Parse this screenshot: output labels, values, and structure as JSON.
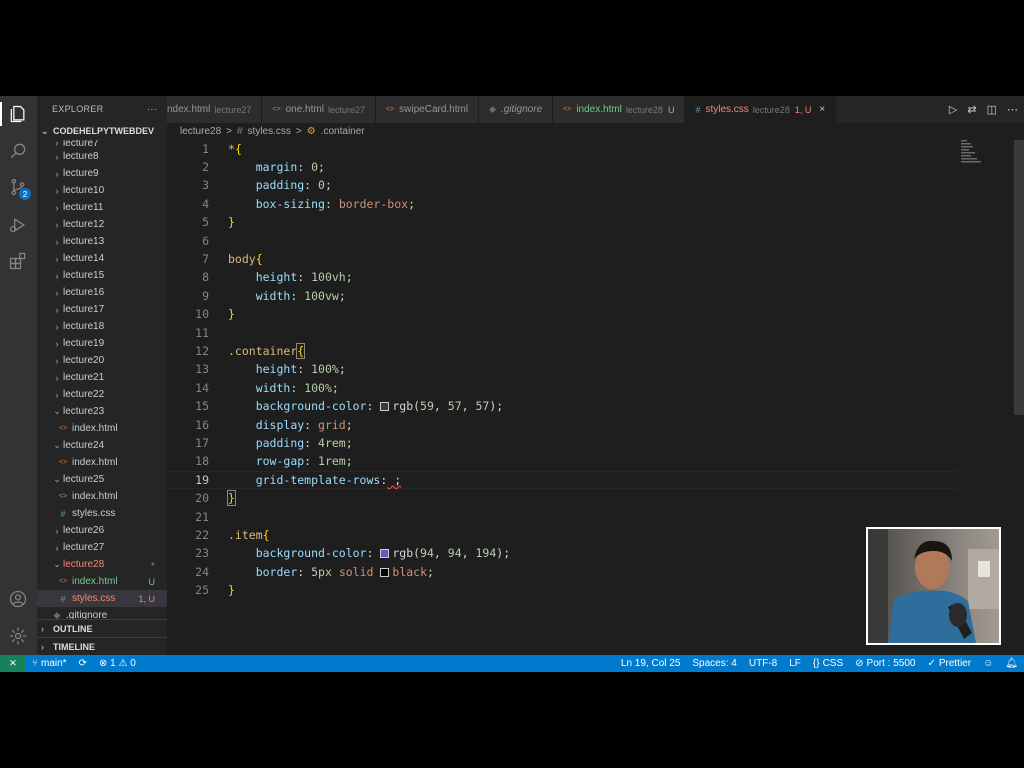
{
  "sidebar": {
    "title": "EXPLORER",
    "more": "···",
    "root": "CODEHELPYTWEBDEV",
    "partial_item": "lecture7",
    "items": [
      {
        "label": "lecture8",
        "type": "folder",
        "open": false
      },
      {
        "label": "lecture9",
        "type": "folder",
        "open": false
      },
      {
        "label": "lecture10",
        "type": "folder",
        "open": false
      },
      {
        "label": "lecture11",
        "type": "folder",
        "open": false
      },
      {
        "label": "lecture12",
        "type": "folder",
        "open": false
      },
      {
        "label": "lecture13",
        "type": "folder",
        "open": false
      },
      {
        "label": "lecture14",
        "type": "folder",
        "open": false
      },
      {
        "label": "lecture15",
        "type": "folder",
        "open": false
      },
      {
        "label": "lecture16",
        "type": "folder",
        "open": false
      },
      {
        "label": "lecture17",
        "type": "folder",
        "open": false
      },
      {
        "label": "lecture18",
        "type": "folder",
        "open": false
      },
      {
        "label": "lecture19",
        "type": "folder",
        "open": false
      },
      {
        "label": "lecture20",
        "type": "folder",
        "open": false
      },
      {
        "label": "lecture21",
        "type": "folder",
        "open": false
      },
      {
        "label": "lecture22",
        "type": "folder",
        "open": false
      },
      {
        "label": "lecture23",
        "type": "folder",
        "open": true
      },
      {
        "label": "index.html",
        "type": "html",
        "indent": 1
      },
      {
        "label": "lecture24",
        "type": "folder",
        "open": true
      },
      {
        "label": "index.html",
        "type": "html",
        "indent": 1
      },
      {
        "label": "lecture25",
        "type": "folder",
        "open": true
      },
      {
        "label": "index.html",
        "type": "html",
        "indent": 1
      },
      {
        "label": "styles.css",
        "type": "css",
        "indent": 1
      },
      {
        "label": "lecture26",
        "type": "folder",
        "open": false
      },
      {
        "label": "lecture27",
        "type": "folder",
        "open": false
      },
      {
        "label": "lecture28",
        "type": "folder",
        "open": true,
        "status": "dot"
      },
      {
        "label": "index.html",
        "type": "html",
        "indent": 1,
        "status": "U"
      },
      {
        "label": "styles.css",
        "type": "css",
        "indent": 1,
        "status": "1, U",
        "selected": true
      },
      {
        "label": ".gitignore",
        "type": "git",
        "indent": 0
      }
    ],
    "outline": "OUTLINE",
    "timeline": "TIMELINE"
  },
  "activity": {
    "scm_badge": "2"
  },
  "tabs": [
    {
      "name": "ndex.html",
      "dir": "lecture27",
      "icon": "html"
    },
    {
      "name": "one.html",
      "dir": "lecture27",
      "icon": "html"
    },
    {
      "name": "swipeCard.html",
      "dir": "",
      "icon": "html"
    },
    {
      "name": ".gitignore",
      "dir": "",
      "icon": "git"
    },
    {
      "name": "index.html",
      "dir": "lecture28",
      "suffix": "U",
      "icon": "html"
    },
    {
      "name": "styles.css",
      "dir": "lecture28",
      "suffix": "1, U",
      "icon": "css",
      "active": true
    }
  ],
  "breadcrumb": {
    "folder": "lecture28",
    "file": "styles.css",
    "symbol": ".container",
    "sep": ">"
  },
  "editor": {
    "current_line": 19,
    "lines": [
      "1",
      "2",
      "3",
      "4",
      "5",
      "6",
      "7",
      "8",
      "9",
      "10",
      "11",
      "12",
      "13",
      "14",
      "15",
      "16",
      "17",
      "18",
      "19",
      "20",
      "21",
      "22",
      "23",
      "24",
      "25"
    ],
    "code": {
      "l1_sel": "*",
      "l1_open": "{",
      "l2_prop": "margin",
      "l2_val": "0",
      "l3_prop": "padding",
      "l3_val": "0",
      "l4_prop": "box-sizing",
      "l4_val": "border-box",
      "close": "}",
      "l7_sel": "body",
      "l8_prop": "height",
      "l8_val": "100vh",
      "l9_prop": "width",
      "l9_val": "100vw",
      "l12_sel": ".container",
      "l13_prop": "height",
      "l13_val": "100%",
      "l14_prop": "width",
      "l14_val": "100%",
      "l15_prop": "background-color",
      "l15_fn": "rgb(",
      "l15_a": "59",
      "l15_b": "57",
      "l15_c": "57",
      "l15_end": ");",
      "l16_prop": "display",
      "l16_val": "grid",
      "l17_prop": "padding",
      "l17_val": "4rem",
      "l18_prop": "row-gap",
      "l18_val": "1rem",
      "l19_prop": "grid-template-rows",
      "l19_val": " ;",
      "l22_sel": ".item",
      "l23_prop": "background-color",
      "l23_fn": "rgb(",
      "l23_a": "94",
      "l23_b": "94",
      "l23_c": "194",
      "l23_end": ");",
      "l24_prop": "border",
      "l24_a": "5px",
      "l24_b": "solid",
      "l24_c": "black"
    },
    "swatches": {
      "l15": "#3b3939",
      "l23": "#5e5ec2",
      "l24": "#000000"
    }
  },
  "status": {
    "branch": "main*",
    "sync": "⟳",
    "problems": "⊗ 1 ⚠ 0",
    "position": "Ln 19, Col 25",
    "spaces": "Spaces: 4",
    "encoding": "UTF-8",
    "eol": "LF",
    "language": "CSS",
    "port": "Port : 5500",
    "prettier": "Prettier"
  }
}
